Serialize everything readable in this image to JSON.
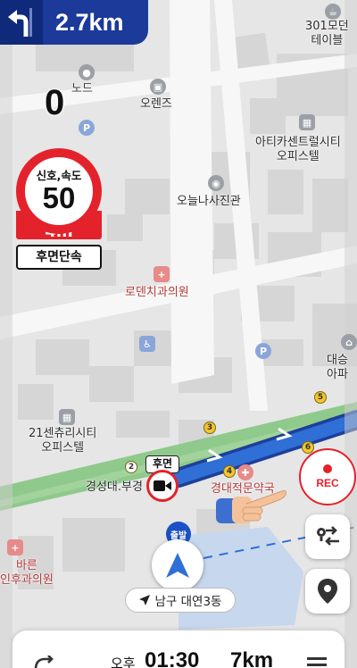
{
  "navigation": {
    "turn_distance": "2.7km",
    "current_speed": "0"
  },
  "speed_camera": {
    "type_label": "신호,속도",
    "speed_limit": "50",
    "distance": "4m",
    "kind_label": "후면단속"
  },
  "map": {
    "poi_labels": {
      "node": "노드",
      "orange": "오렌즈",
      "modern_table": "301모던\n테이블",
      "arica_center": "아티카센트럴시티\n오피스텔",
      "photo_studio": "오늘나사진관",
      "dental": "로덴치과의원",
      "century_city": "21센츄리시티\n오피스텔",
      "kyungsung_station": "경성대.부경",
      "kyungdae_pharmacy": "경대적문약국",
      "daeyeon_apt": "대승\n아파",
      "exit": "출발",
      "barun_clinic": "바른\n인후과의원"
    },
    "stops": [
      "2",
      "3",
      "4",
      "5",
      "6"
    ],
    "parking_symbol": "P"
  },
  "rear_camera": {
    "tag": "후면"
  },
  "location": {
    "area_name": "남구 대연3동"
  },
  "controls": {
    "rec_label": "REC"
  },
  "bottom_bar": {
    "ampm": "오후",
    "arrival_time": "01:30",
    "remaining_distance": "7km"
  },
  "colors": {
    "banner_blue": "#1b3a99",
    "alert_red": "#e4222b",
    "route_blue": "#2f6fd6",
    "road_green": "#8fc98b"
  }
}
